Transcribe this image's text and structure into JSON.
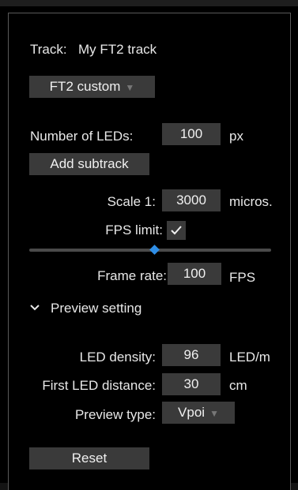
{
  "track": {
    "label": "Track:",
    "name": "My FT2 track"
  },
  "preset": {
    "selected": "FT2 custom"
  },
  "leds": {
    "label": "Number of LEDs:",
    "value": "100",
    "unit": "px"
  },
  "add_subtrack_label": "Add subtrack",
  "scale": {
    "label": "Scale 1:",
    "value": "3000",
    "unit": "micros."
  },
  "fps_limit": {
    "label": "FPS limit:",
    "checked": true
  },
  "frame_rate_slider": {
    "level": 0.52
  },
  "frame_rate": {
    "label": "Frame rate:",
    "value": "100",
    "unit": "FPS"
  },
  "preview_section": {
    "title": "Preview setting",
    "expanded": true
  },
  "led_density": {
    "label": "LED density:",
    "value": "96",
    "unit": "LED/m"
  },
  "first_led_distance": {
    "label": "First LED distance:",
    "value": "30",
    "unit": "cm"
  },
  "preview_type": {
    "label": "Preview type:",
    "selected": "Vpoi"
  },
  "reset_label": "Reset",
  "colors": {
    "accent": "#2f8ee6",
    "control_bg": "#3a3a3a",
    "panel_bg": "#000000"
  }
}
